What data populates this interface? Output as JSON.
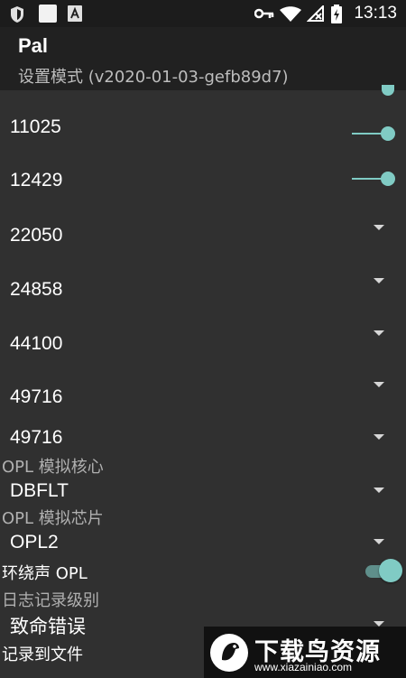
{
  "status_bar": {
    "time": "13:13",
    "icons": [
      "shield-icon",
      "square-icon",
      "a-badge-icon",
      "key-icon",
      "wifi-icon",
      "no-sim-icon",
      "battery-charging-icon"
    ]
  },
  "app_bar": {
    "title": "Pal",
    "subtitle": "设置模式 (v2020-01-03-gefb89d7)"
  },
  "settings": {
    "rows": [
      {
        "label": "11025",
        "control": "slider"
      },
      {
        "label": "12429",
        "control": "slider"
      },
      {
        "label": "22050",
        "control": "dropdown"
      },
      {
        "label": "24858",
        "control": "dropdown"
      },
      {
        "label": "44100",
        "control": "dropdown"
      },
      {
        "label": "49716",
        "control": "dropdown"
      },
      {
        "label": "49716",
        "control": "dropdown"
      }
    ],
    "opl_core": {
      "label": "OPL 模拟核心",
      "value": "DBFLT"
    },
    "opl_chip": {
      "label": "OPL 模拟芯片",
      "value": "OPL2"
    },
    "surround_opl": {
      "label": "环绕声 OPL",
      "enabled": true
    },
    "log_level": {
      "label": "日志记录级别",
      "value": "致命错误"
    },
    "log_to_file": {
      "label": "记录到文件"
    }
  },
  "colors": {
    "accent": "#80cbc4",
    "background": "#303030",
    "app_bar": "#212121"
  },
  "watermark": {
    "brand": "下载鸟资源",
    "url": "www.xiazainiao.com"
  }
}
